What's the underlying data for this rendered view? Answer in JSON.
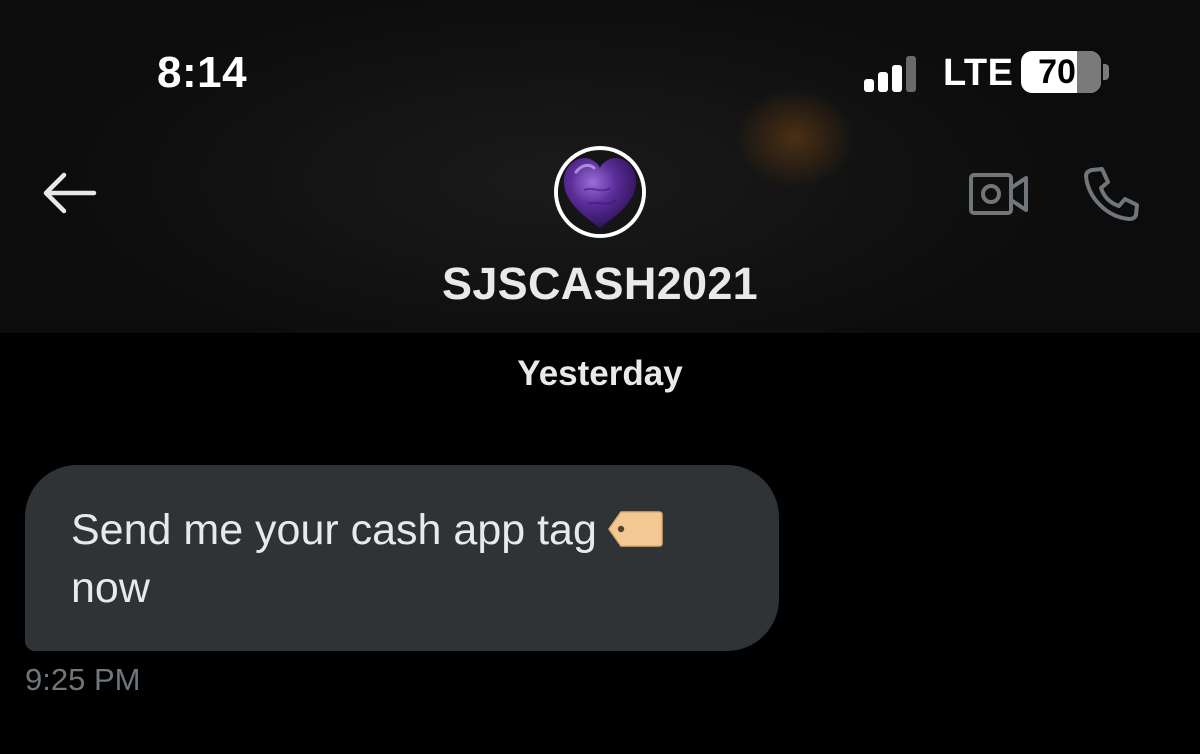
{
  "status_bar": {
    "time": "8:14",
    "network": "LTE",
    "battery_level": "70",
    "battery_fraction": 0.7,
    "signal_bars_active": 3,
    "signal_bars_total": 4
  },
  "header": {
    "contact_name": "SJSCASH2021",
    "avatar": "purple-heart-stone-avatar",
    "icons": {
      "back": "arrow-left-icon",
      "video": "video-camera-icon",
      "call": "phone-icon"
    }
  },
  "conversation": {
    "date_separator": "Yesterday",
    "messages": [
      {
        "text": "Send me your cash app tag",
        "text_line2": "now",
        "emoji": "label-tag-icon",
        "time": "9:25 PM"
      }
    ]
  },
  "colors": {
    "background": "#000000",
    "bubble": "#2f3336",
    "text": "#e7e9ea",
    "muted": "#71767b",
    "avatar_purple": "#5b2d99"
  }
}
